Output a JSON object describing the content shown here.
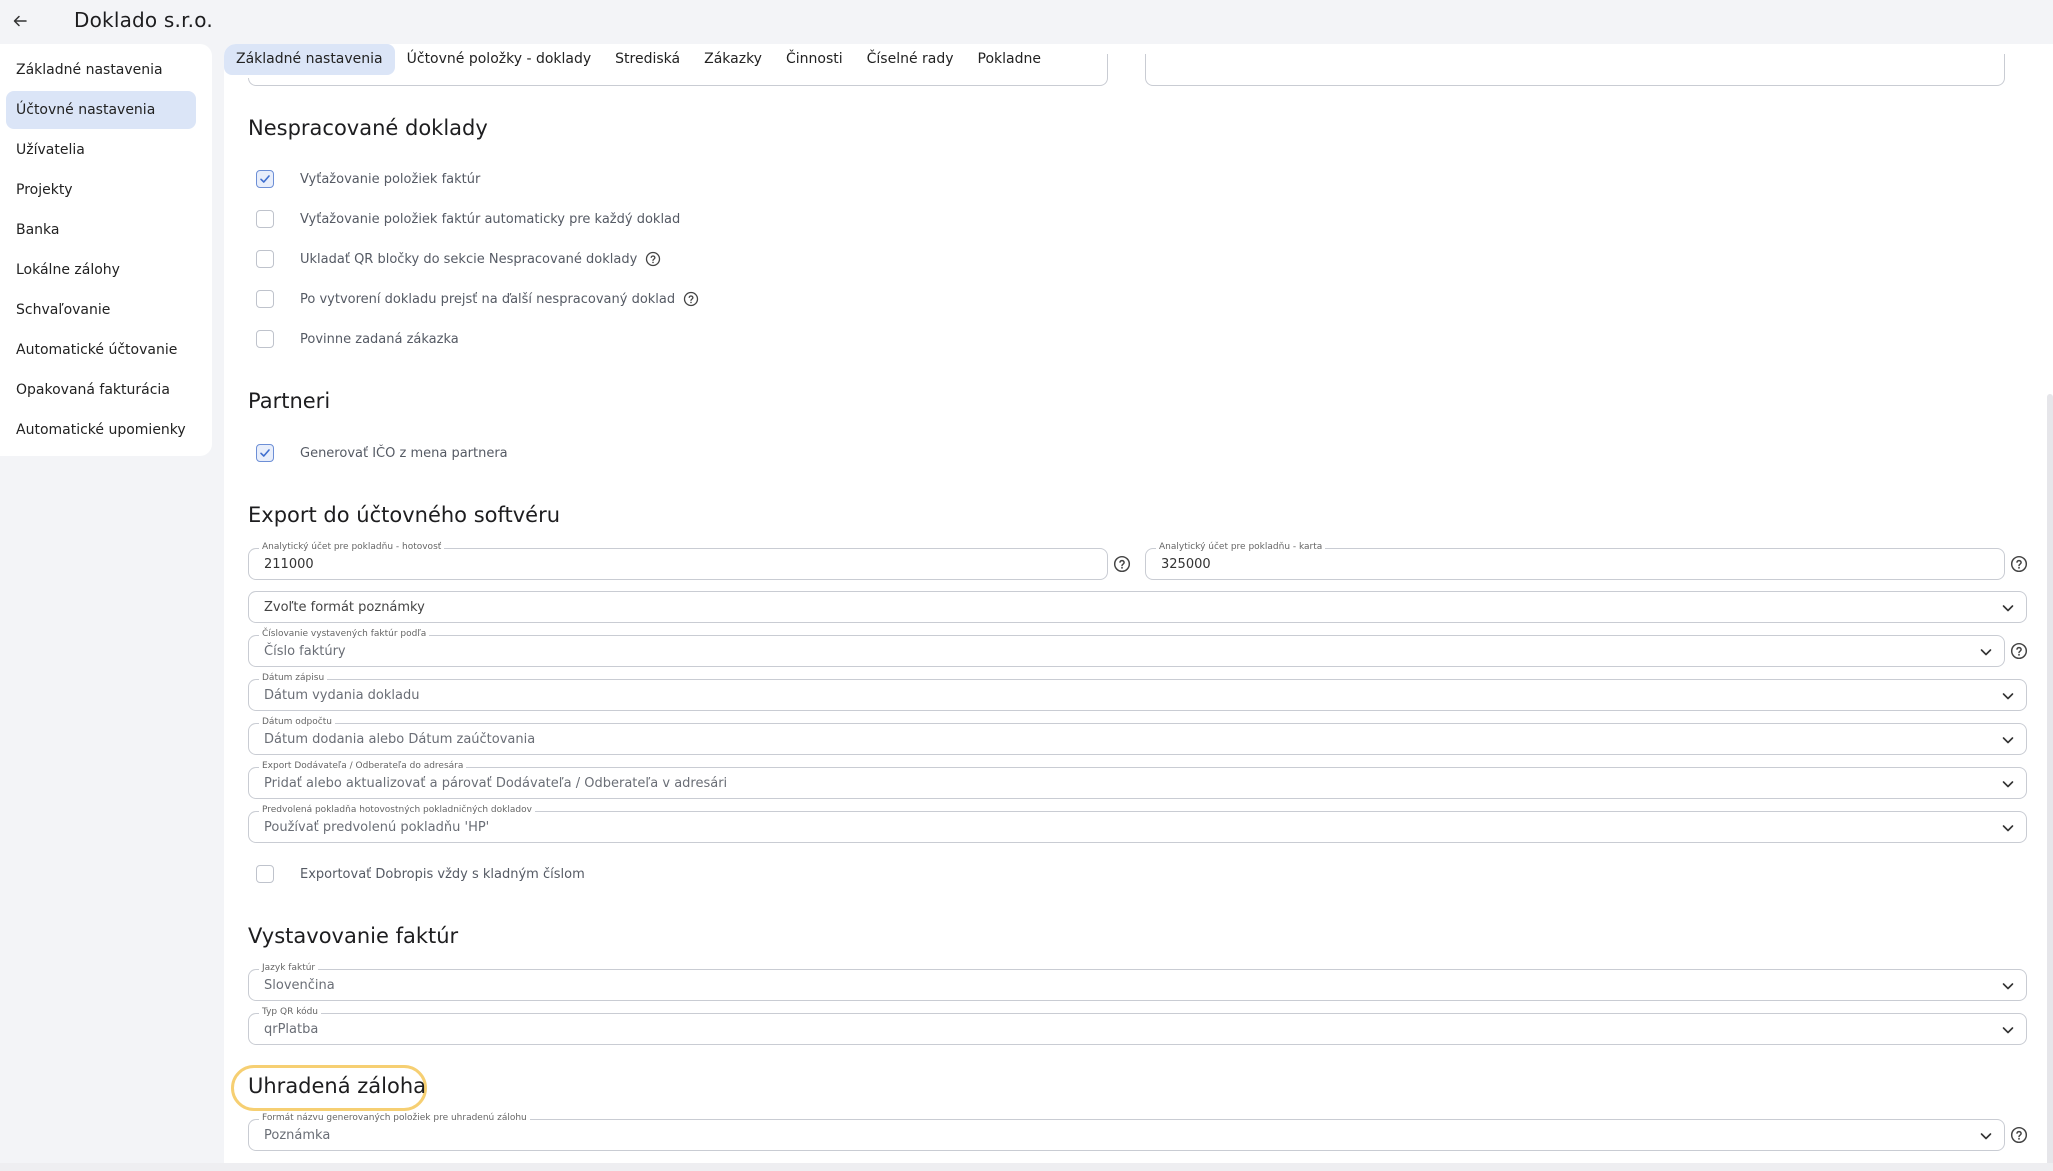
{
  "app": {
    "title": "Doklado s.r.o."
  },
  "sidebar": {
    "items": [
      {
        "label": "Základné nastavenia"
      },
      {
        "label": "Účtovné nastavenia"
      },
      {
        "label": "Užívatelia"
      },
      {
        "label": "Projekty"
      },
      {
        "label": "Banka"
      },
      {
        "label": "Lokálne zálohy"
      },
      {
        "label": "Schvaľovanie"
      },
      {
        "label": "Automatické účtovanie"
      },
      {
        "label": "Opakovaná fakturácia"
      },
      {
        "label": "Automatické upomienky"
      }
    ],
    "active_index": 1
  },
  "tabs": [
    {
      "label": "Základné nastavenia"
    },
    {
      "label": "Účtovné položky - doklady"
    },
    {
      "label": "Strediská"
    },
    {
      "label": "Zákazky"
    },
    {
      "label": "Činnosti"
    },
    {
      "label": "Číselné rady"
    },
    {
      "label": "Pokladne"
    }
  ],
  "sections": {
    "unprocessed": {
      "title": "Nespracované doklady",
      "options": [
        {
          "label": "Vyťažovanie položiek faktúr",
          "checked": true
        },
        {
          "label": "Vyťažovanie položiek faktúr automaticky pre každý doklad",
          "checked": false
        },
        {
          "label": "Ukladať QR bločky do sekcie Nespracované doklady",
          "checked": false
        },
        {
          "label": "Po vytvorení dokladu prejsť na ďalší nespracovaný doklad",
          "checked": false
        },
        {
          "label": "Povinne zadaná zákazka",
          "checked": false
        }
      ]
    },
    "partners": {
      "title": "Partneri",
      "options": [
        {
          "label": "Generovať IČO z mena partnera",
          "checked": true
        }
      ]
    },
    "export": {
      "title": "Export do účtovného softvéru",
      "cash_account": {
        "label": "Analytický účet pre pokladňu - hotovosť",
        "value": "211000"
      },
      "card_account": {
        "label": "Analytický účet pre pokladňu - karta",
        "value": "325000"
      },
      "note_format": {
        "label": "",
        "value": "Zvoľte formát poznámky"
      },
      "invoice_numbering": {
        "label": "Číslovanie vystavených faktúr podľa",
        "value": "Číslo faktúry"
      },
      "entry_date": {
        "label": "Dátum zápisu",
        "value": "Dátum vydania dokladu"
      },
      "deduction_date": {
        "label": "Dátum odpočtu",
        "value": "Dátum dodania alebo Dátum zaúčtovania"
      },
      "address_export": {
        "label": "Export Dodávateľa / Odberateľa do adresára",
        "value": "Pridať alebo aktualizovať a párovať Dodávateľa / Odberateľa v adresári"
      },
      "default_cashdesk": {
        "label": "Predvolená pokladňa hotovostných pokladničných dokladov",
        "value": "Používať predvolenú pokladňu 'HP'"
      },
      "credit_note_option": {
        "label": "Exportovať Dobropis vždy s kladným číslom",
        "checked": false
      }
    },
    "invoicing": {
      "title": "Vystavovanie faktúr",
      "language": {
        "label": "Jazyk faktúr",
        "value": "Slovenčina"
      },
      "qr_type": {
        "label": "Typ QR kódu",
        "value": "qrPlatba"
      }
    },
    "paid_deposit": {
      "title": "Uhradená záloha",
      "name_format": {
        "label": "Formát názvu generovaných položiek pre uhradenú zálohu",
        "value": "Poznámka"
      }
    }
  },
  "colors": {
    "accent": "#dbe5f7",
    "highlight": "#f6cf72",
    "check": "#6d8fd6"
  }
}
